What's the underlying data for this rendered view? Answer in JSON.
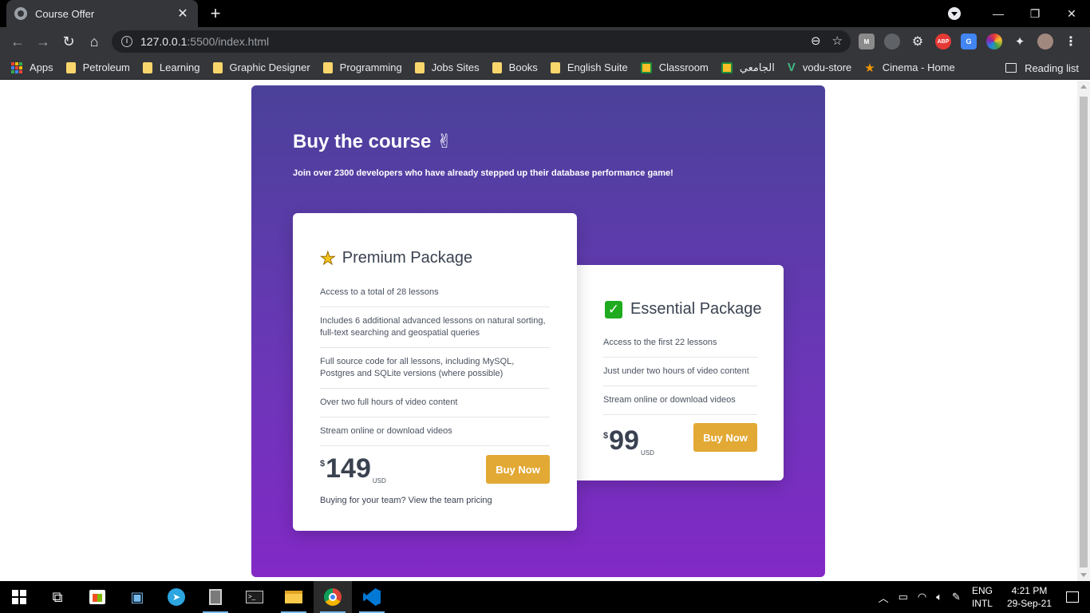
{
  "browser": {
    "tab_title": "Course Offer",
    "url_host": "127.0.0.1",
    "url_path": ":5500/index.html",
    "bookmarks": [
      {
        "label": "Apps",
        "icon": "apps-grid-icon"
      },
      {
        "label": "Petroleum",
        "icon": "folder-icon"
      },
      {
        "label": "Learning",
        "icon": "folder-icon"
      },
      {
        "label": "Graphic Designer",
        "icon": "folder-icon"
      },
      {
        "label": "Programming",
        "icon": "folder-icon"
      },
      {
        "label": "Jobs Sites",
        "icon": "folder-icon"
      },
      {
        "label": "Books",
        "icon": "folder-icon"
      },
      {
        "label": "English Suite",
        "icon": "folder-icon"
      },
      {
        "label": "Classroom",
        "icon": "classroom-icon"
      },
      {
        "label": "الجامعي",
        "icon": "classroom-icon"
      },
      {
        "label": "vodu-store",
        "icon": "vue-icon"
      },
      {
        "label": "Cinema - Home",
        "icon": "star-icon"
      }
    ],
    "reading_list": "Reading list",
    "extensions": [
      "M",
      "",
      "",
      "ABP",
      "G",
      "",
      "",
      "",
      ""
    ]
  },
  "page": {
    "title": "Buy the course ✌",
    "subtitle": "Join over 2300 developers who have already stepped up their database performance game!",
    "premium": {
      "name": "Premium Package",
      "features": [
        "Access to a total of 28 lessons",
        "Includes 6 additional advanced lessons on natural sorting, full-text searching and geospatial queries",
        "Full source code for all lessons, including MySQL, Postgres and SQLite versions (where possible)",
        "Over two full hours of video content",
        "Stream online or download videos"
      ],
      "currency": "$",
      "price": "149",
      "unit": "USD",
      "button": "Buy Now",
      "team_note": "Buying for your team? View the team pricing"
    },
    "essential": {
      "name": "Essential Package",
      "features": [
        "Access to the first 22 lessons",
        "Just under two hours of video content",
        "Stream online or download videos"
      ],
      "currency": "$",
      "price": "99",
      "unit": "USD",
      "button": "Buy Now"
    },
    "colors": {
      "gradient_top": "#4a4199",
      "gradient_bottom": "#8229c6",
      "button": "#e3a935",
      "text": "#3a4250"
    }
  },
  "taskbar": {
    "lang_top": "ENG",
    "lang_bottom": "INTL",
    "time": "4:21 PM",
    "date": "29-Sep-21"
  }
}
